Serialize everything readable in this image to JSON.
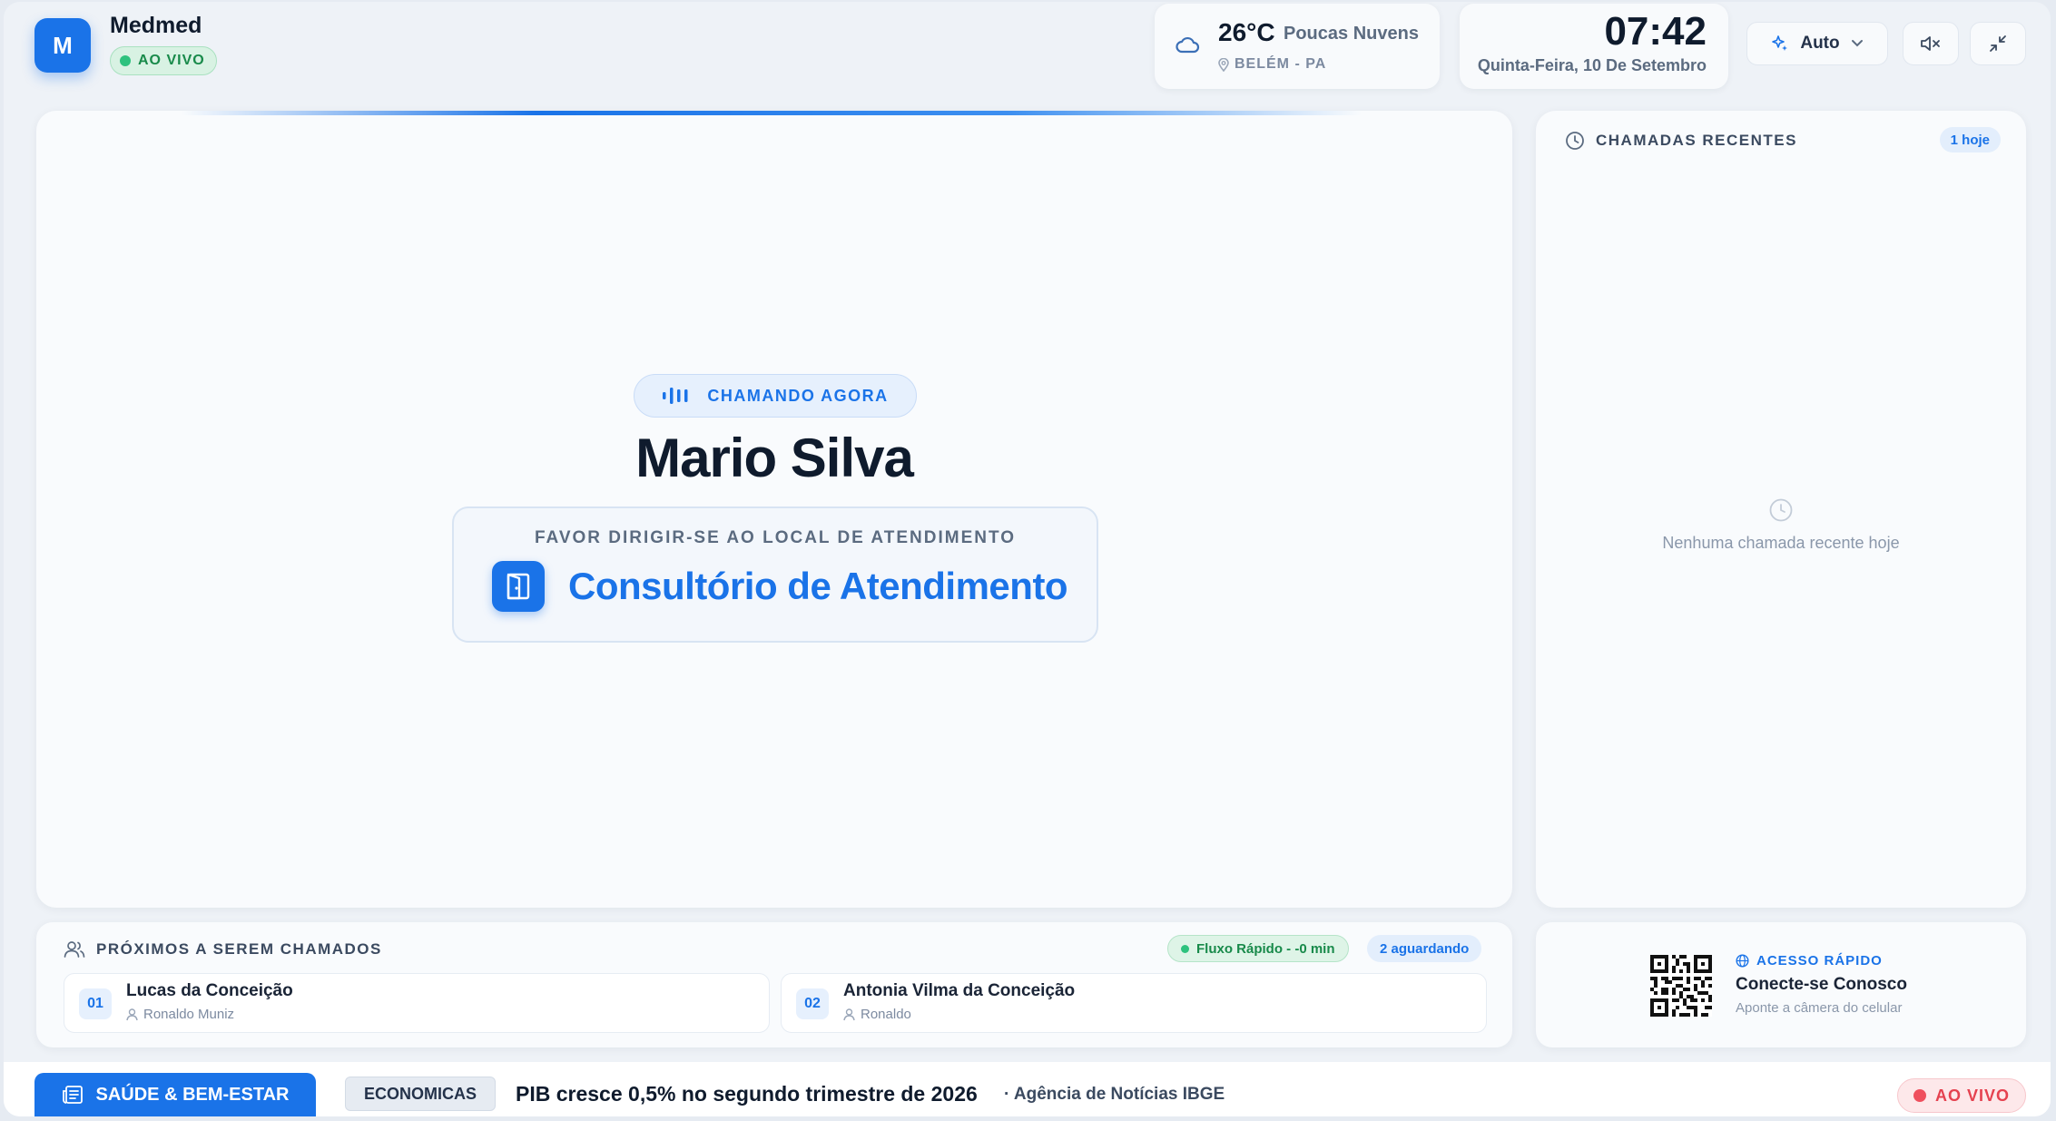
{
  "brand": {
    "initial": "M",
    "name": "Medmed",
    "live_label": "AO VIVO"
  },
  "weather": {
    "icon": "cloud-icon",
    "temperature": "26°C",
    "condition": "Poucas Nuvens",
    "location": "BELÉM - PA"
  },
  "clock": {
    "time": "07:42",
    "date": "Quinta-Feira, 10 De Setembro"
  },
  "controls": {
    "mode_label": "Auto",
    "mute_icon": "speaker-muted-icon",
    "minimize_icon": "collapse-icon"
  },
  "calling": {
    "badge": "CHAMANDO AGORA",
    "patient": "Mario Silva",
    "instruction": "FAVOR DIRIGIR-SE AO LOCAL DE ATENDIMENTO",
    "destination": "Consultório de Atendimento"
  },
  "recent": {
    "title": "CHAMADAS RECENTES",
    "badge": "1 hoje",
    "empty_message": "Nenhuma chamada recente hoje"
  },
  "next": {
    "title": "PRÓXIMOS A SEREM CHAMADOS",
    "flow_badge": "Fluxo Rápido - -0 min",
    "waiting_badge": "2 aguardando",
    "queue": [
      {
        "number": "01",
        "name": "Lucas da Conceição",
        "doctor": "Ronaldo Muniz"
      },
      {
        "number": "02",
        "name": "Antonia Vilma da Conceição",
        "doctor": "Ronaldo"
      }
    ]
  },
  "quick_access": {
    "label": "ACESSO RÁPIDO",
    "title": "Conecte-se Conosco",
    "subtitle": "Aponte a câmera do celular"
  },
  "ticker": {
    "category": "SAÚDE & BEM-ESTAR",
    "tag": "ECONOMICAS",
    "headline": "PIB cresce 0,5% no segundo trimestre de 2026",
    "source": "· Agência de Notícias IBGE",
    "live_label": "AO VIVO"
  },
  "colors": {
    "accent": "#1a73e8",
    "live_green": "#2ec27e",
    "live_red": "#ef4f5d"
  }
}
